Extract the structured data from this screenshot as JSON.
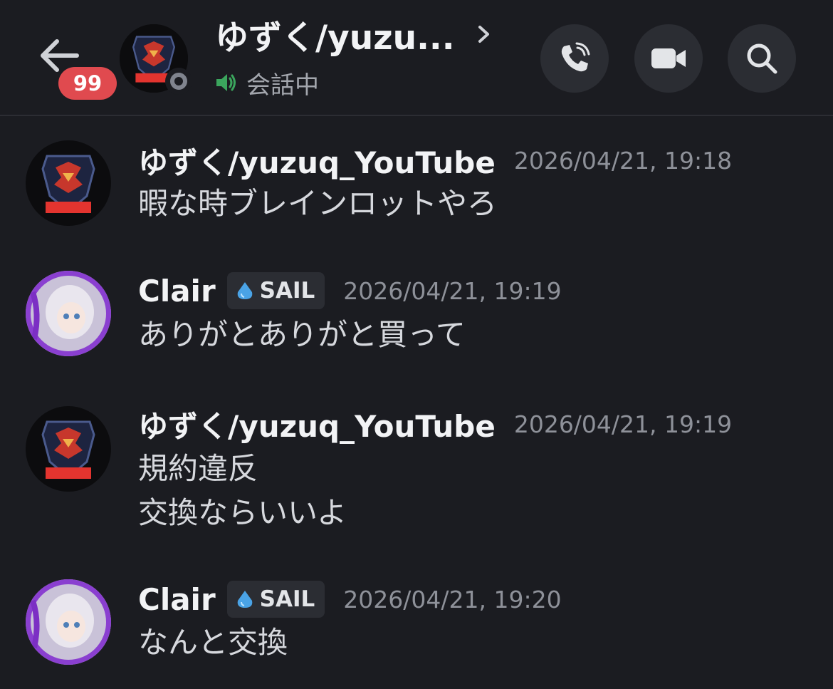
{
  "header": {
    "unread_count": "99",
    "title": "ゆずく/yuzu...",
    "subtitle": "会話中",
    "icons": [
      "back-arrow-icon",
      "chevron-right-icon",
      "voice-call-icon",
      "video-call-icon",
      "search-icon",
      "speaker-icon"
    ]
  },
  "messages": [
    {
      "author": "ゆずく/yuzuq_YouTube",
      "tag": "",
      "time": "2026/04/21, 19:18",
      "lines": [
        "暇な時ブレインロットやろ"
      ]
    },
    {
      "author": "Clair",
      "tag": "SAIL",
      "time": "2026/04/21, 19:19",
      "lines": [
        "ありがとありがと買って"
      ]
    },
    {
      "author": "ゆずく/yuzuq_YouTube",
      "tag": "",
      "time": "2026/04/21, 19:19",
      "lines": [
        "規約違反",
        "交換ならいいよ"
      ]
    },
    {
      "author": "Clair",
      "tag": "SAIL",
      "time": "2026/04/21, 19:20",
      "lines": [
        "なんと交換"
      ]
    }
  ],
  "colors": {
    "background": "#1b1c21",
    "badge": "#e04a4f",
    "speaker": "#3ba55d",
    "tag_icon": "#4aa3e6",
    "avatar_red": "#e3342f"
  }
}
